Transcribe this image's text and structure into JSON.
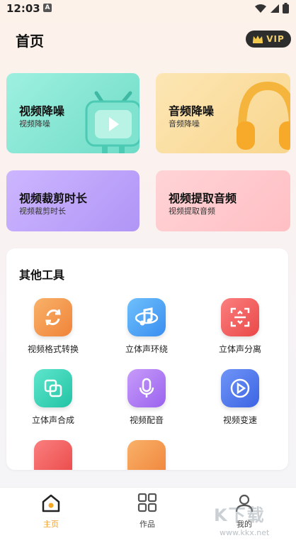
{
  "status": {
    "time": "12:03",
    "badge": "A"
  },
  "header": {
    "title": "首页",
    "vip_label": "VIP"
  },
  "cards": [
    {
      "title": "视频降噪",
      "sub": "视频降噪"
    },
    {
      "title": "音频降噪",
      "sub": "音频降噪"
    },
    {
      "title": "视频裁剪时长",
      "sub": "视频裁剪时长"
    },
    {
      "title": "视频提取音频",
      "sub": "视频提取音频"
    }
  ],
  "tools": {
    "heading": "其他工具",
    "items": [
      {
        "label": "视频格式转换",
        "icon": "convert-icon",
        "color": "#f39a4a"
      },
      {
        "label": "立体声环绕",
        "icon": "music-surround-icon",
        "color": "#4aa3f5"
      },
      {
        "label": "立体声分离",
        "icon": "separate-icon",
        "color": "#f25c5c"
      },
      {
        "label": "立体声合成",
        "icon": "merge-icon",
        "color": "#2fcfb3"
      },
      {
        "label": "视频配音",
        "icon": "microphone-icon",
        "color": "#b07af2"
      },
      {
        "label": "视频变速",
        "icon": "play-speed-icon",
        "color": "#4f78ee"
      }
    ]
  },
  "tabbar": [
    {
      "label": "主页",
      "icon": "home-icon",
      "active": true
    },
    {
      "label": "作品",
      "icon": "grid-icon",
      "active": false
    },
    {
      "label": "我的",
      "icon": "user-icon",
      "active": false
    }
  ],
  "watermark": {
    "text": "K下载",
    "url": "www.kkx.net"
  }
}
